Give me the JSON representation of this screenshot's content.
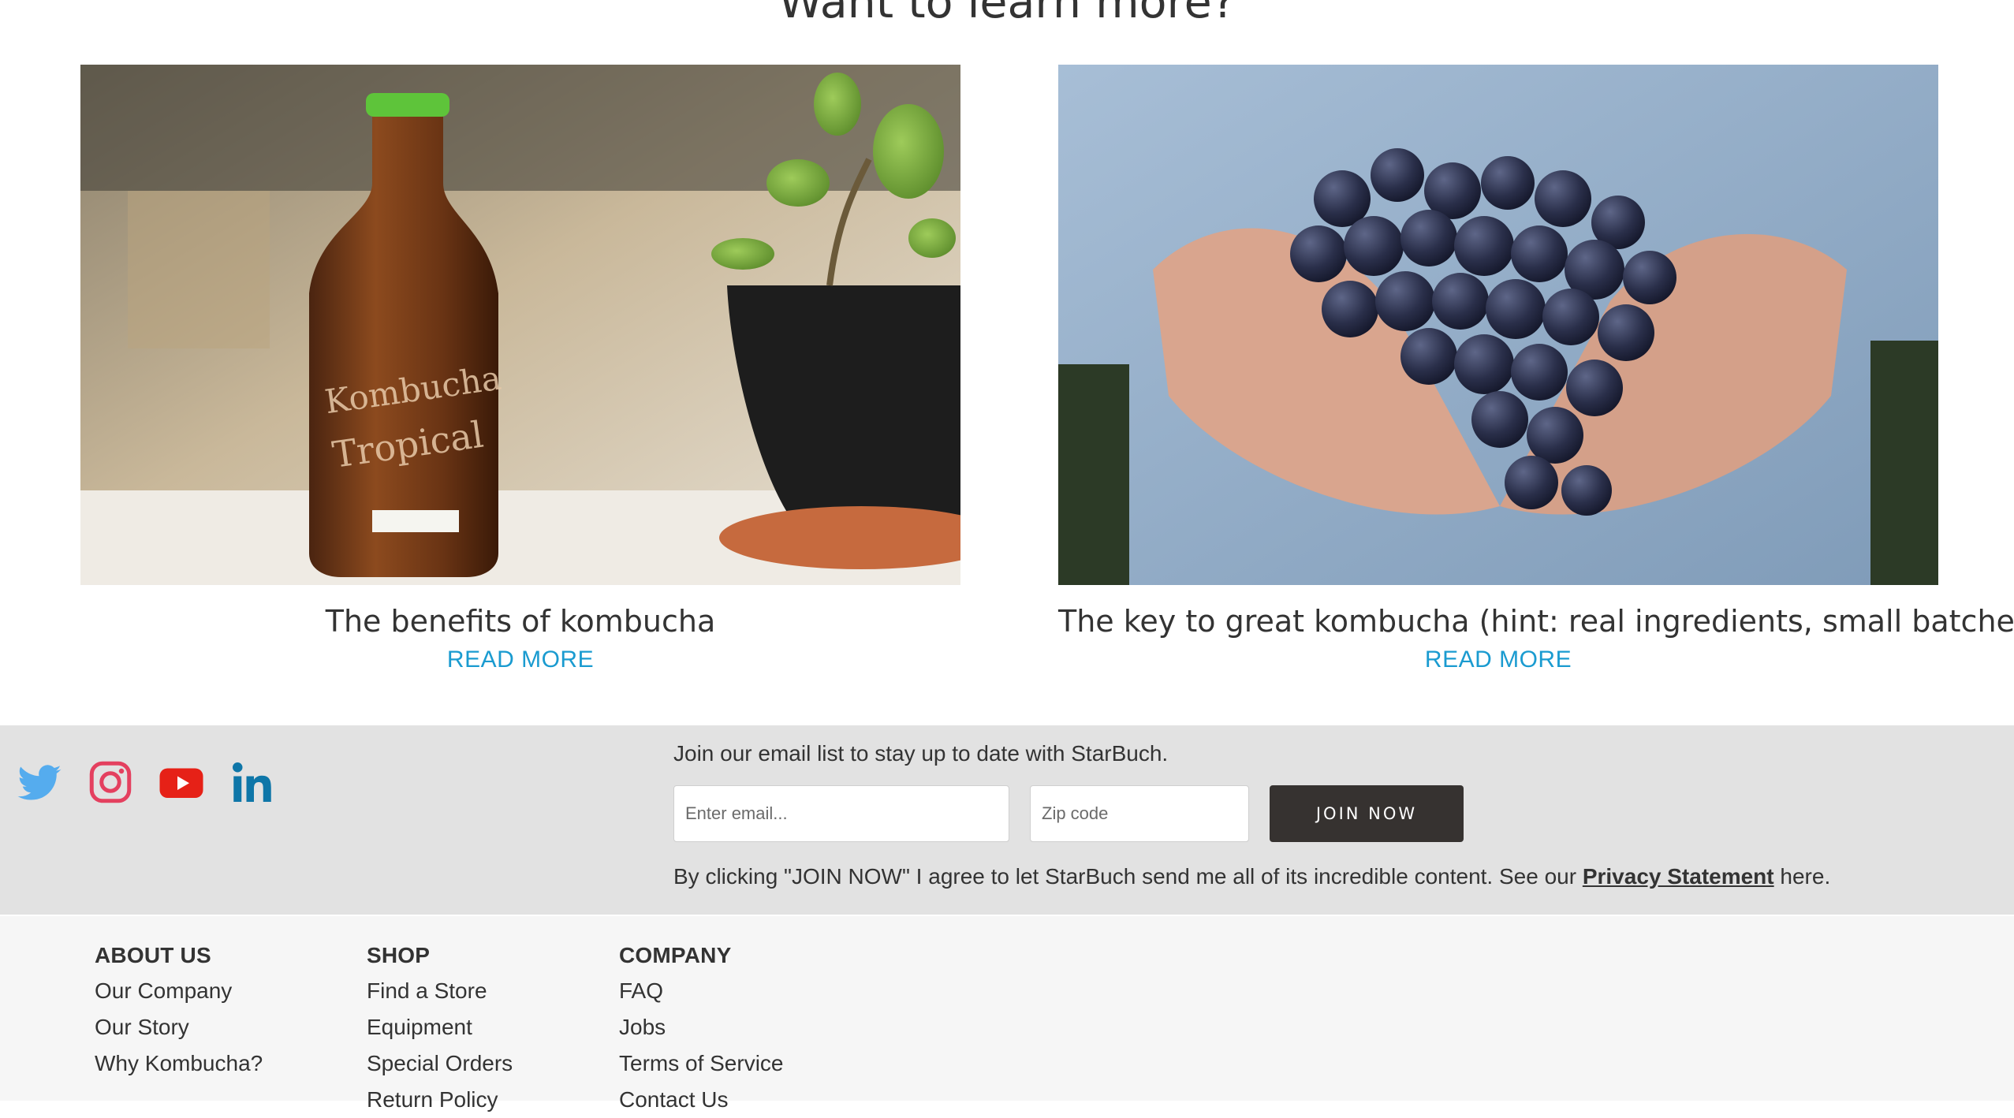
{
  "section": {
    "title": "Want to learn more?"
  },
  "articles": [
    {
      "title": "The benefits of kombucha",
      "cta": "READ MORE",
      "image": "kombucha-bottle-photo",
      "bottle_text": [
        "Kombucha",
        "Tropical"
      ]
    },
    {
      "title": "The key to great kombucha (hint: real ingredients, small batches)",
      "cta": "READ MORE",
      "image": "grapes-in-hands-photo"
    }
  ],
  "social": [
    {
      "name": "twitter-icon",
      "color": "#55acee"
    },
    {
      "name": "instagram-icon",
      "color": "#e4405f"
    },
    {
      "name": "youtube-icon",
      "color": "#e62117"
    },
    {
      "name": "linkedin-icon",
      "color": "#0e76a8"
    }
  ],
  "newsletter": {
    "intro": "Join our email list to stay up to date with StarBuch.",
    "email_placeholder": "Enter email...",
    "zip_placeholder": "Zip code",
    "button_label": "JOIN NOW",
    "consent_prefix": "By clicking \"JOIN NOW\" I agree to let StarBuch send me all of its incredible content. See our",
    "privacy_link": "Privacy Statement",
    "consent_suffix": "here."
  },
  "footer": {
    "columns": [
      {
        "heading": "ABOUT US",
        "links": [
          "Our Company",
          "Our Story",
          "Why Kombucha?"
        ]
      },
      {
        "heading": "SHOP",
        "links": [
          "Find a Store",
          "Equipment",
          "Special Orders",
          "Return Policy"
        ]
      },
      {
        "heading": "COMPANY",
        "links": [
          "FAQ",
          "Jobs",
          "Terms of Service",
          "Contact Us"
        ]
      }
    ]
  },
  "colors": {
    "accent": "#1a9bd0",
    "band_bg": "#e2e2e2",
    "footer_bg": "#f6f6f6",
    "button_bg": "#363230"
  }
}
